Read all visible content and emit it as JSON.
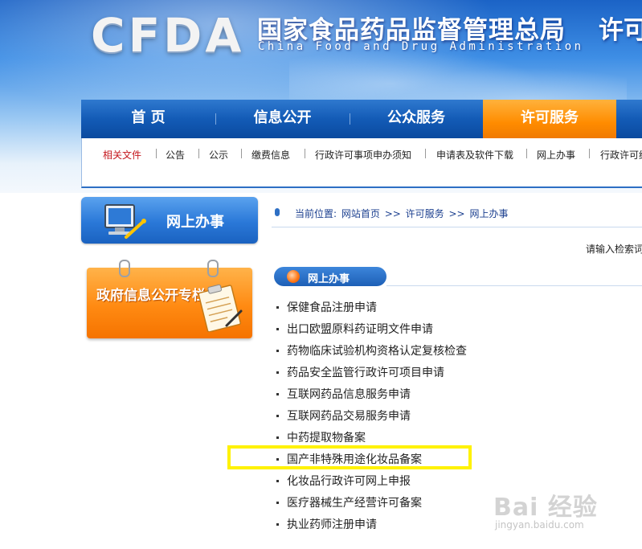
{
  "header": {
    "logo": "CFDA",
    "title_cn": "国家食品药品监督管理总局",
    "title_en": "China Food and Drug Administration",
    "title_right": "许可"
  },
  "nav": {
    "items": [
      {
        "label": "首 页"
      },
      {
        "label": "信息公开"
      },
      {
        "label": "公众服务"
      },
      {
        "label": "许可服务"
      }
    ],
    "active_index": 3
  },
  "subnav": {
    "items": [
      {
        "label": "相关文件"
      },
      {
        "label": "公告"
      },
      {
        "label": "公示"
      },
      {
        "label": "缴费信息"
      },
      {
        "label": "行政许可事项申办须知"
      },
      {
        "label": "申请表及软件下载"
      },
      {
        "label": "网上办事"
      },
      {
        "label": "行政许可结"
      }
    ]
  },
  "sidebar": {
    "online_button": "网上办事",
    "gov_panel": "政府信息公开专栏"
  },
  "breadcrumb": {
    "prefix": "当前位置:",
    "home": "网站首页",
    "sep": ">>",
    "level1": "许可服务",
    "level2": "网上办事"
  },
  "search_hint": "请输入检索词",
  "section": {
    "title": "网上办事",
    "items": [
      {
        "label": "保健食品注册申请"
      },
      {
        "label": "出口欧盟原料药证明文件申请"
      },
      {
        "label": "药物临床试验机构资格认定复核检查"
      },
      {
        "label": "药品安全监管行政许可项目申请"
      },
      {
        "label": "互联网药品信息服务申请"
      },
      {
        "label": "互联网药品交易服务申请"
      },
      {
        "label": "中药提取物备案"
      },
      {
        "label": "国产非特殊用途化妆品备案"
      },
      {
        "label": "化妆品行政许可网上申报"
      },
      {
        "label": "医疗器械生产经营许可备案"
      },
      {
        "label": "执业药师注册申请"
      }
    ],
    "highlighted_index": 7
  },
  "watermark": {
    "logo": "Bai 经验",
    "url": "jingyan.baidu.com"
  },
  "colors": {
    "nav_blue": "#135bb6",
    "nav_active": "#ff8c00",
    "highlight": "#fff200",
    "link_red": "#c4161c"
  }
}
